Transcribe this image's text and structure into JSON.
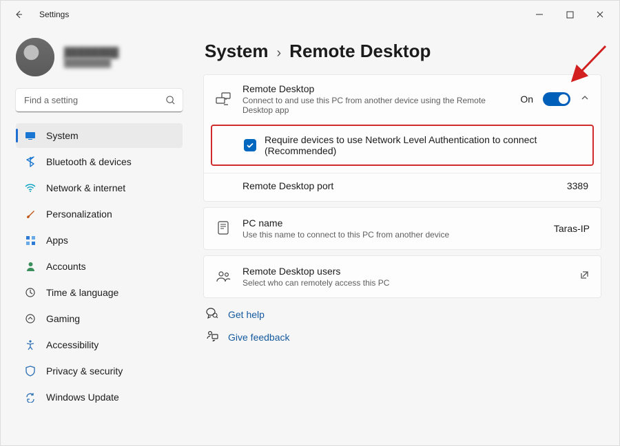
{
  "window": {
    "title": "Settings"
  },
  "account": {
    "display_name": "████████",
    "secondary": "████████"
  },
  "search": {
    "placeholder": "Find a setting"
  },
  "sidebar": {
    "items": [
      {
        "label": "System"
      },
      {
        "label": "Bluetooth & devices"
      },
      {
        "label": "Network & internet"
      },
      {
        "label": "Personalization"
      },
      {
        "label": "Apps"
      },
      {
        "label": "Accounts"
      },
      {
        "label": "Time & language"
      },
      {
        "label": "Gaming"
      },
      {
        "label": "Accessibility"
      },
      {
        "label": "Privacy & security"
      },
      {
        "label": "Windows Update"
      }
    ]
  },
  "breadcrumb": {
    "root": "System",
    "leaf": "Remote Desktop"
  },
  "rd": {
    "title": "Remote Desktop",
    "subtitle": "Connect to and use this PC from another device using the Remote Desktop app",
    "toggle_label": "On",
    "toggle_on": true,
    "nla_label": "Require devices to use Network Level Authentication to connect (Recommended)",
    "nla_checked": true,
    "port_label": "Remote Desktop port",
    "port_value": "3389"
  },
  "pc_name": {
    "title": "PC name",
    "subtitle": "Use this name to connect to this PC from another device",
    "value": "Taras-IP"
  },
  "users": {
    "title": "Remote Desktop users",
    "subtitle": "Select who can remotely access this PC"
  },
  "links": {
    "help": "Get help",
    "feedback": "Give feedback"
  }
}
